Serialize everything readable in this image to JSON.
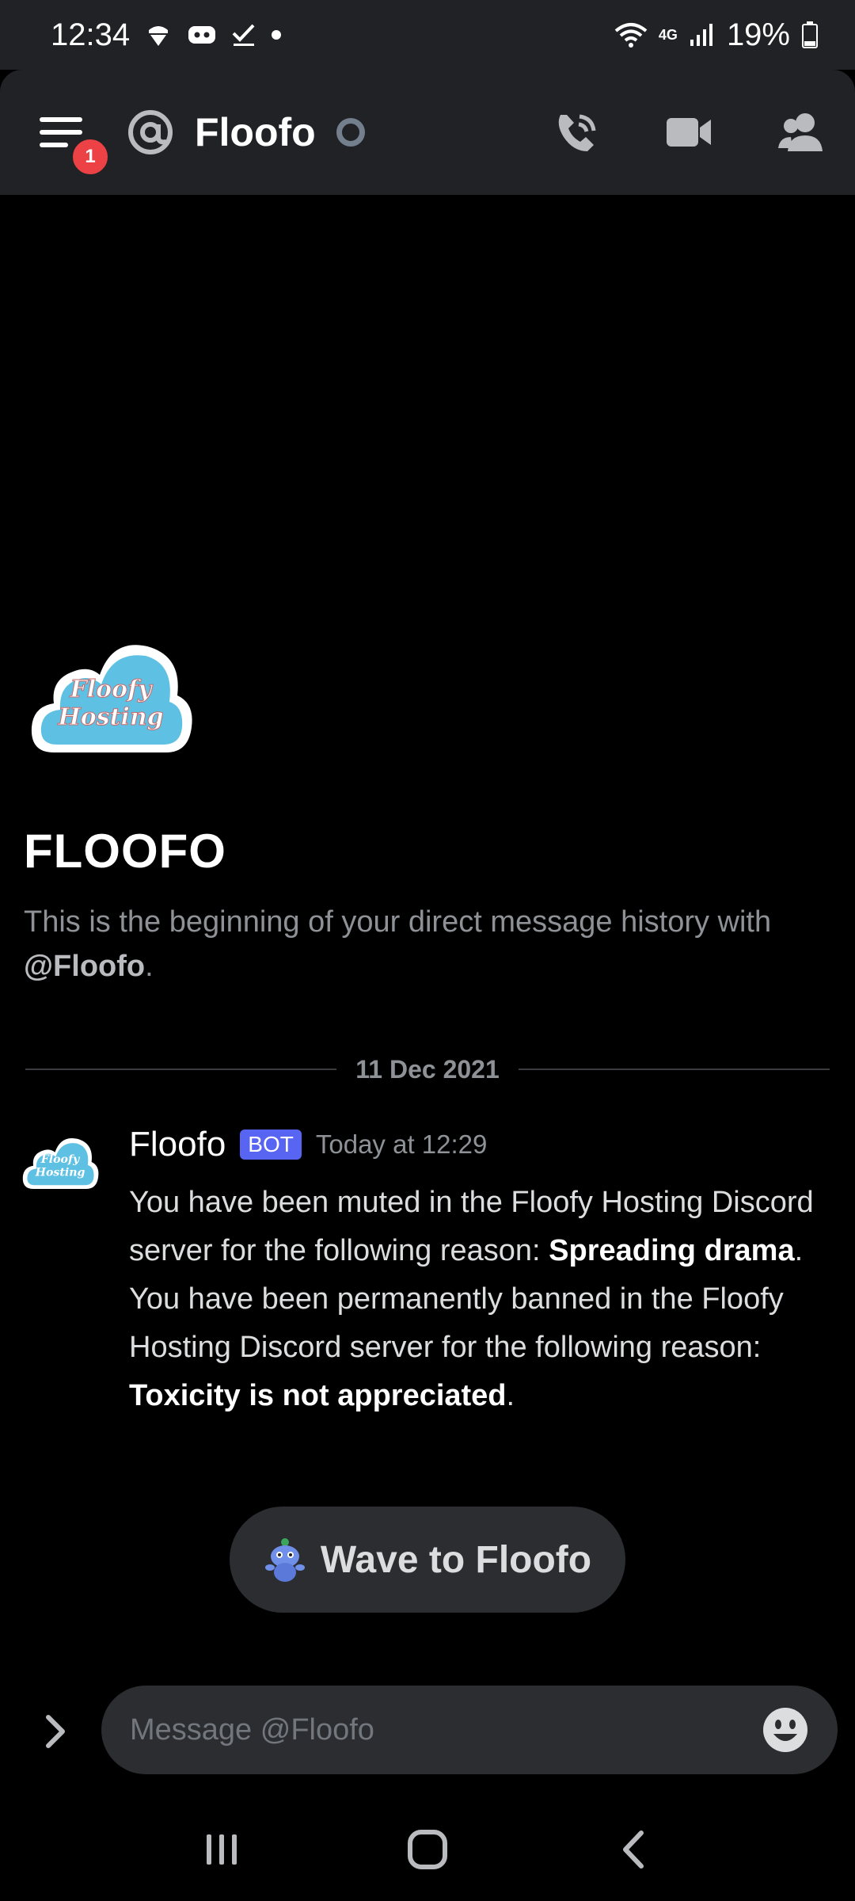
{
  "status_bar": {
    "time": "12:34",
    "battery": "19%",
    "network": "4G"
  },
  "header": {
    "title": "Floofo",
    "notification_count": "1"
  },
  "intro": {
    "avatar_text_line1": "Floofy",
    "avatar_text_line2": "Hosting",
    "name": "FLOOFO",
    "text_prefix": "This is the beginning of your direct message history with ",
    "mention": "@Floofo",
    "text_suffix": "."
  },
  "date_divider": "11 Dec 2021",
  "message": {
    "author": "Floofo",
    "tag": "BOT",
    "time": "Today at 12:29",
    "line1_prefix": "You have been muted in the Floofy Hosting Discord server for the following reason: ",
    "line1_bold": "Spreading drama",
    "line1_suffix": ".",
    "line2_prefix": "You have been permanently banned in the Floofy Hosting Discord server for the following reason: ",
    "line2_bold": "Toxicity is not appreciated",
    "line2_suffix": "."
  },
  "wave_button": {
    "label": "Wave to Floofo"
  },
  "composer": {
    "placeholder": "Message @Floofo"
  },
  "colors": {
    "header_bg": "#202225",
    "background": "#000000",
    "bot_tag": "#5865f2",
    "badge": "#ed4245",
    "input_bg": "#2b2d31"
  },
  "icons": {
    "header": [
      "menu-icon",
      "at-icon",
      "status-idle-icon",
      "call-icon",
      "video-icon",
      "members-icon"
    ],
    "composer": [
      "chevron-right-icon",
      "emoji-icon"
    ],
    "nav": [
      "recents-icon",
      "home-icon",
      "back-icon"
    ]
  }
}
